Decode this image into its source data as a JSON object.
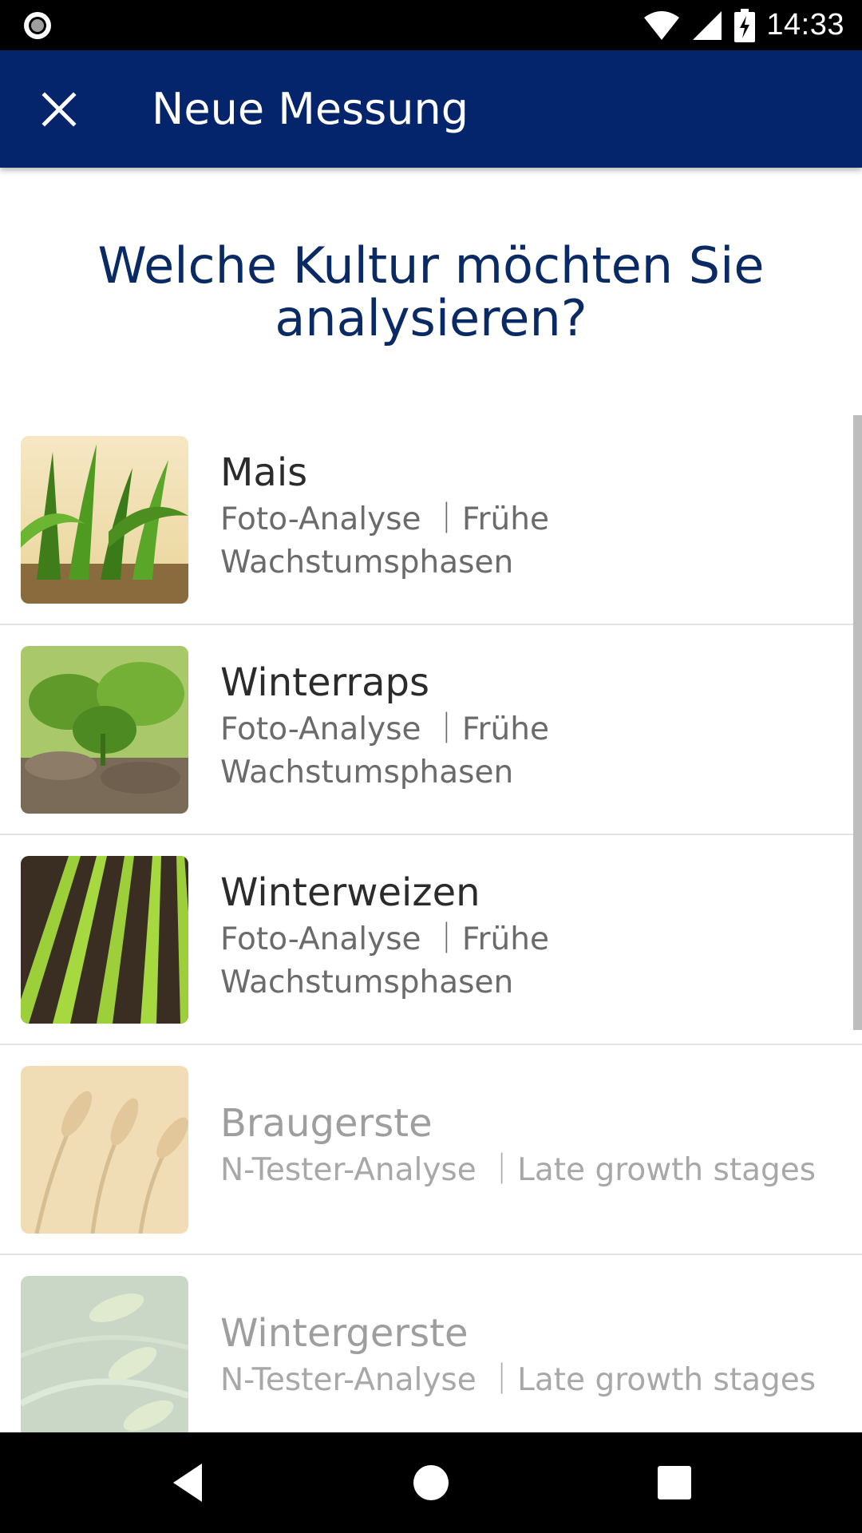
{
  "status_bar": {
    "time": "14:33",
    "icons": [
      "record-icon",
      "wifi-icon",
      "signal-icon",
      "battery-charging-icon"
    ]
  },
  "app_bar": {
    "title": "Neue Messung",
    "close_icon": "close-icon",
    "background_color": "#04246b"
  },
  "question": "Welche Kultur möchten Sie analysieren?",
  "crops": [
    {
      "name": "Mais",
      "subtitle_line1": "Foto-Analyse ｜Frühe",
      "subtitle_line2": "Wachstumsphasen",
      "enabled": true
    },
    {
      "name": "Winterraps",
      "subtitle_line1": "Foto-Analyse ｜Frühe",
      "subtitle_line2": "Wachstumsphasen",
      "enabled": true
    },
    {
      "name": "Winterweizen",
      "subtitle_line1": "Foto-Analyse ｜Frühe",
      "subtitle_line2": "Wachstumsphasen",
      "enabled": true
    },
    {
      "name": "Braugerste",
      "subtitle_line1": "N-Tester-Analyse ｜Late growth stages",
      "enabled": false
    },
    {
      "name": "Wintergerste",
      "subtitle_line1": "N-Tester-Analyse ｜Late growth stages",
      "enabled": false
    }
  ],
  "nav_bar": {
    "icons": [
      "back-icon",
      "home-icon",
      "recents-icon"
    ]
  }
}
